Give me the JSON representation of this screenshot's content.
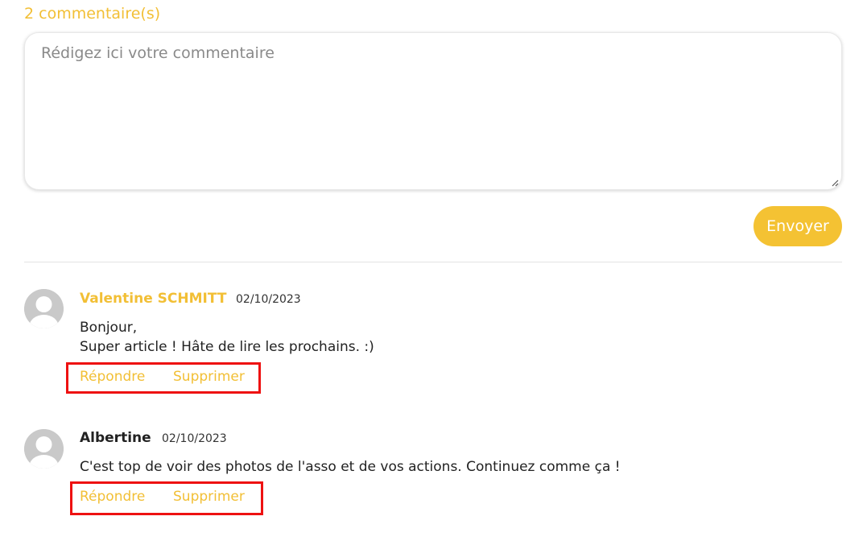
{
  "comments_section": {
    "count_label": "2 commentaire(s)",
    "input": {
      "placeholder": "Rédigez ici votre commentaire",
      "value": ""
    },
    "send_label": "Envoyer",
    "accent_color": "#f4c233",
    "highlight_color": "#ee1111"
  },
  "comments": [
    {
      "author": "Valentine SCHMITT",
      "date": "02/10/2023",
      "lines": [
        "Bonjour,",
        "Super article ! Hâte de lire les prochains. :)"
      ],
      "reply_label": "Répondre",
      "delete_label": "Supprimer",
      "avatar_icon": "default-user-icon"
    },
    {
      "author": "Albertine",
      "date": "02/10/2023",
      "lines": [
        "C'est top de voir des photos de l'asso et de vos actions. Continuez comme ça !"
      ],
      "reply_label": "Répondre",
      "delete_label": "Supprimer",
      "avatar_icon": "default-user-icon"
    }
  ]
}
